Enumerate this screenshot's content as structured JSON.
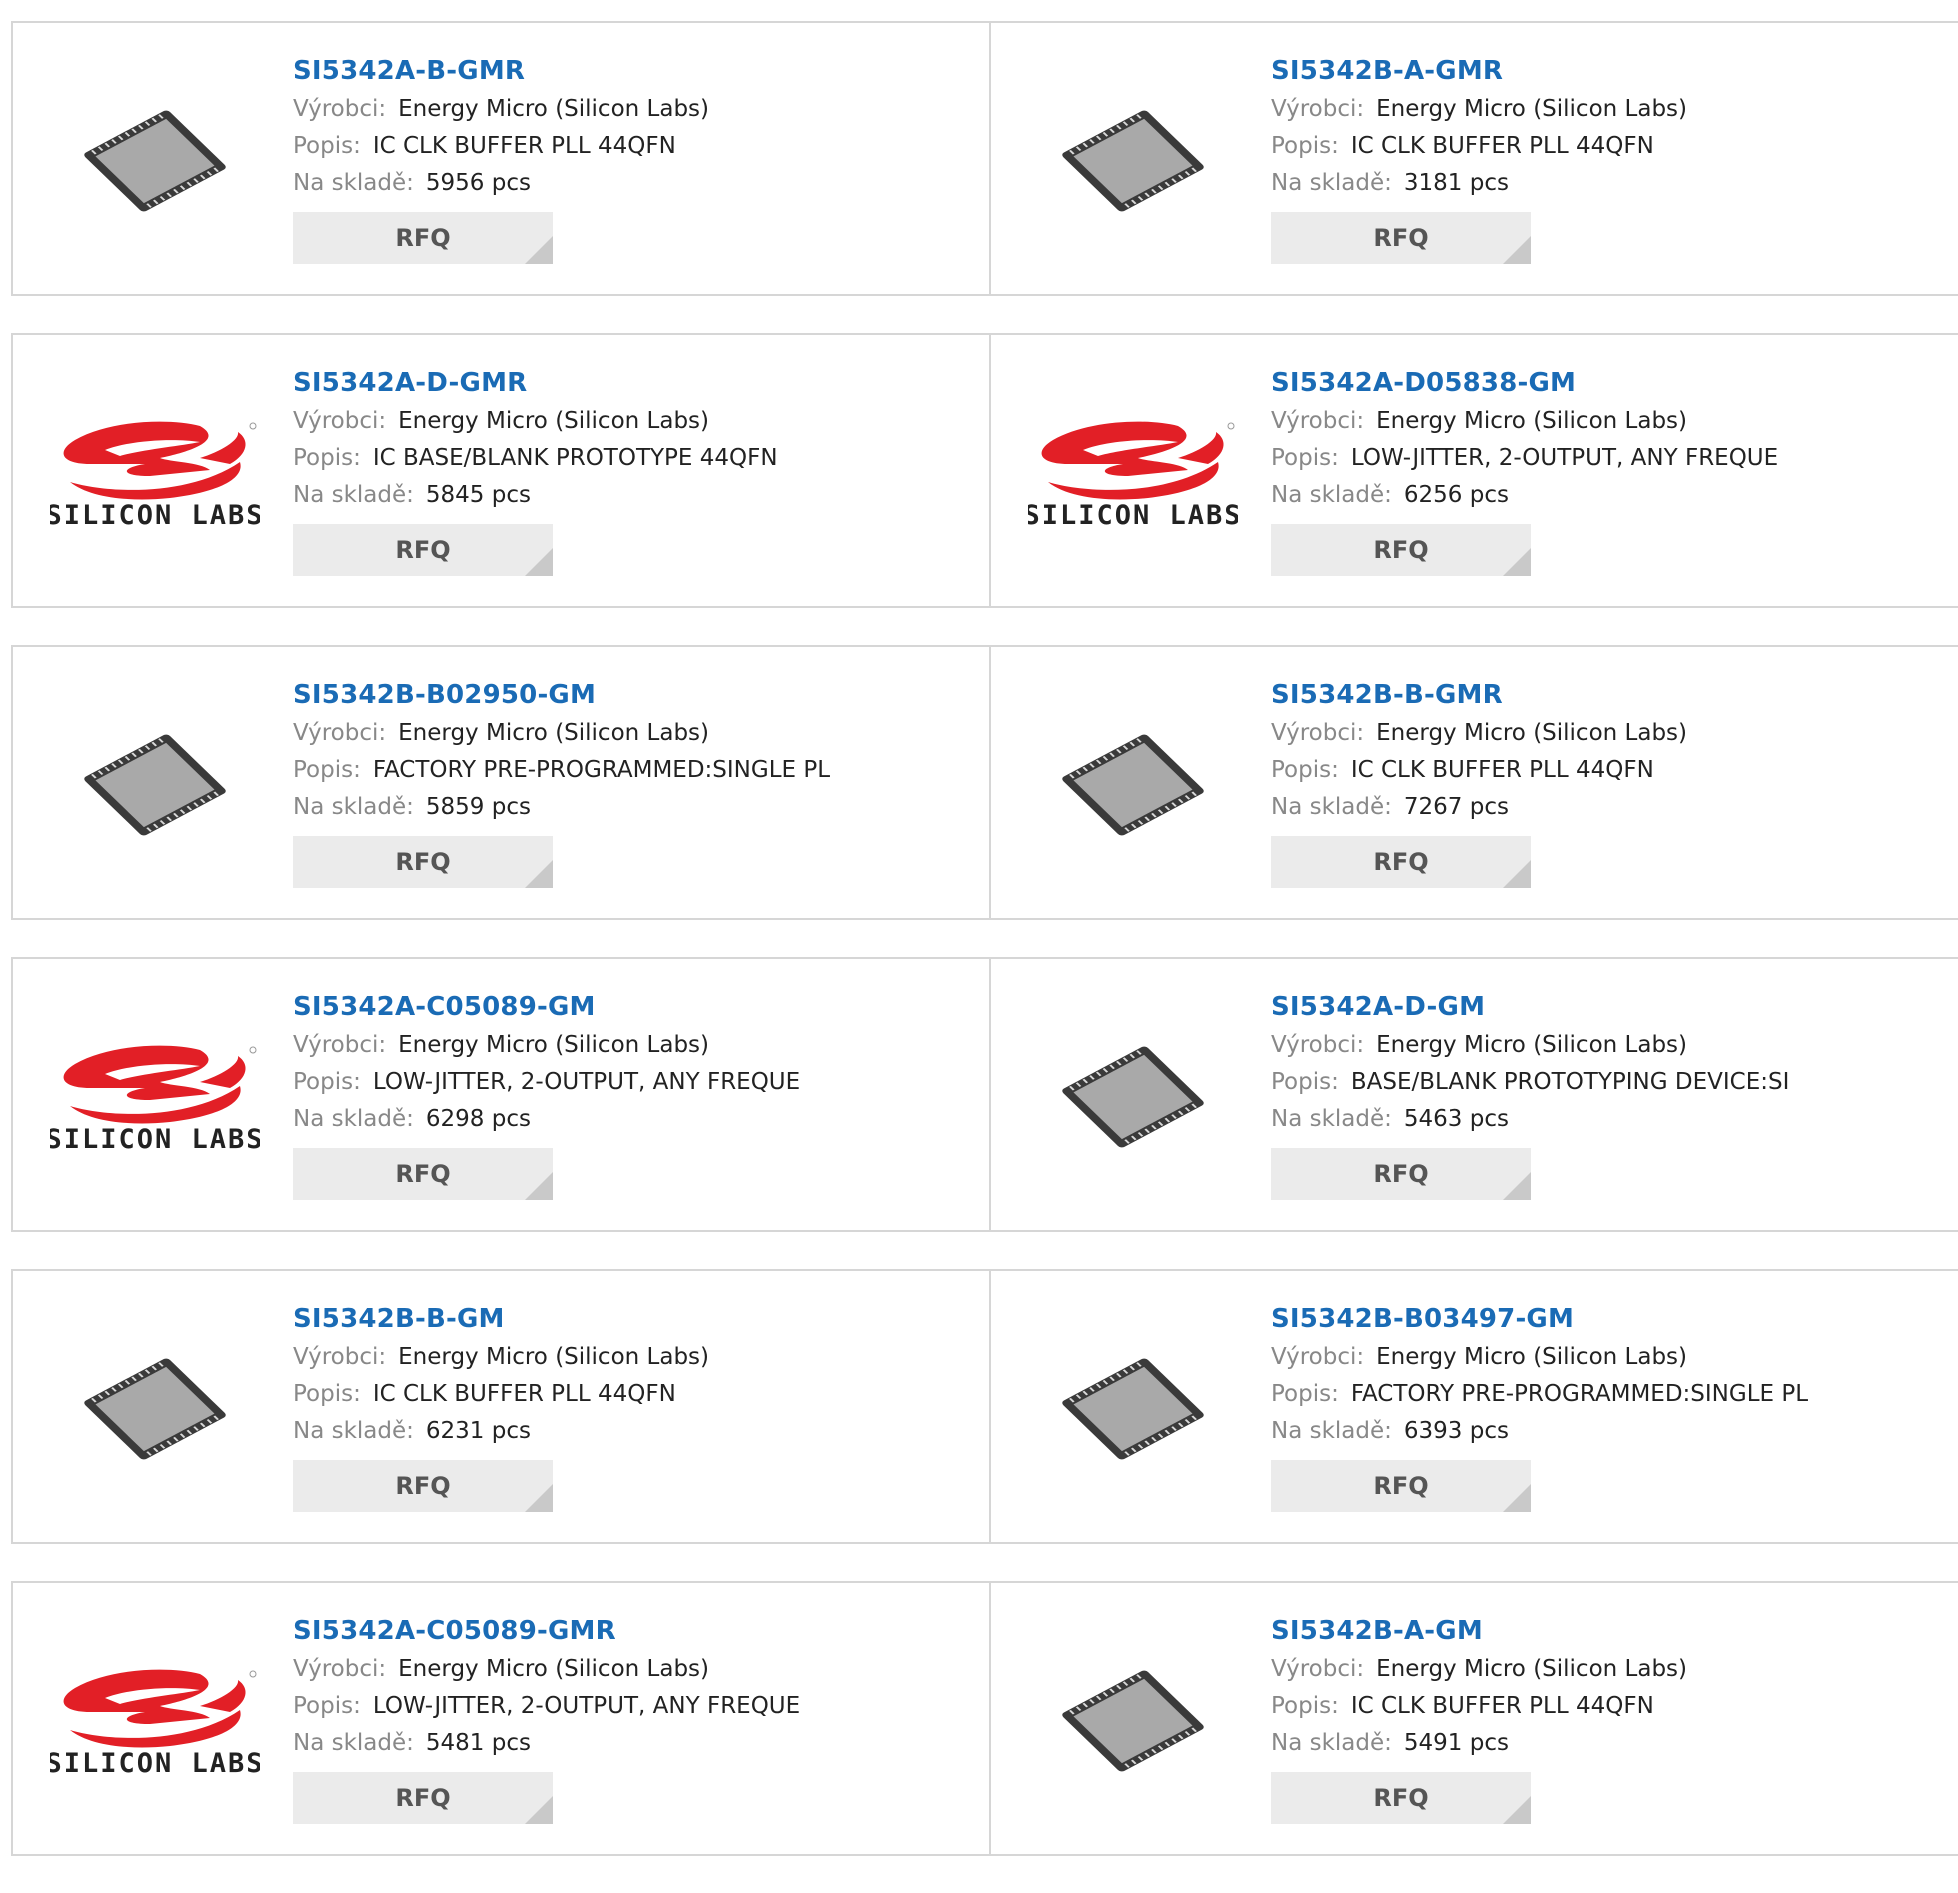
{
  "labels": {
    "manufacturer": "Výrobci:",
    "description": "Popis:",
    "stock": "Na skladě:",
    "rfq": "RFQ"
  },
  "products": [
    {
      "part": "SI5342A-B-GMR",
      "manufacturer": "Energy Micro (Silicon Labs)",
      "description": "IC CLK BUFFER PLL 44QFN",
      "stock": "5956 pcs",
      "image": "chip-icon"
    },
    {
      "part": "SI5342B-A-GMR",
      "manufacturer": "Energy Micro (Silicon Labs)",
      "description": "IC CLK BUFFER PLL 44QFN",
      "stock": "3181 pcs",
      "image": "chip-icon"
    },
    {
      "part": "SI5342A-D-GMR",
      "manufacturer": "Energy Micro (Silicon Labs)",
      "description": "IC BASE/BLANK PROTOTYPE 44QFN",
      "stock": "5845 pcs",
      "image": "silicon-labs-logo",
      "logo_text": "SILICON LABS"
    },
    {
      "part": "SI5342A-D05838-GM",
      "manufacturer": "Energy Micro (Silicon Labs)",
      "description": "LOW-JITTER, 2-OUTPUT, ANY FREQUE",
      "stock": "6256 pcs",
      "image": "silicon-labs-logo",
      "logo_text": "SILICON LABS"
    },
    {
      "part": "SI5342B-B02950-GM",
      "manufacturer": "Energy Micro (Silicon Labs)",
      "description": "FACTORY PRE-PROGRAMMED:SINGLE PL",
      "stock": "5859 pcs",
      "image": "chip-icon"
    },
    {
      "part": "SI5342B-B-GMR",
      "manufacturer": "Energy Micro (Silicon Labs)",
      "description": "IC CLK BUFFER PLL 44QFN",
      "stock": "7267 pcs",
      "image": "chip-icon"
    },
    {
      "part": "SI5342A-C05089-GM",
      "manufacturer": "Energy Micro (Silicon Labs)",
      "description": "LOW-JITTER, 2-OUTPUT, ANY FREQUE",
      "stock": "6298 pcs",
      "image": "silicon-labs-logo",
      "logo_text": "SILICON LABS"
    },
    {
      "part": "SI5342A-D-GM",
      "manufacturer": "Energy Micro (Silicon Labs)",
      "description": "BASE/BLANK PROTOTYPING DEVICE:SI",
      "stock": "5463 pcs",
      "image": "chip-icon"
    },
    {
      "part": "SI5342B-B-GM",
      "manufacturer": "Energy Micro (Silicon Labs)",
      "description": "IC CLK BUFFER PLL 44QFN",
      "stock": "6231 pcs",
      "image": "chip-icon"
    },
    {
      "part": "SI5342B-B03497-GM",
      "manufacturer": "Energy Micro (Silicon Labs)",
      "description": "FACTORY PRE-PROGRAMMED:SINGLE PL",
      "stock": "6393 pcs",
      "image": "chip-icon"
    },
    {
      "part": "SI5342A-C05089-GMR",
      "manufacturer": "Energy Micro (Silicon Labs)",
      "description": "LOW-JITTER, 2-OUTPUT, ANY FREQUE",
      "stock": "5481 pcs",
      "image": "silicon-labs-logo",
      "logo_text": "SILICON LABS"
    },
    {
      "part": "SI5342B-A-GM",
      "manufacturer": "Energy Micro (Silicon Labs)",
      "description": "IC CLK BUFFER PLL 44QFN",
      "stock": "5491 pcs",
      "image": "chip-icon"
    }
  ],
  "colors": {
    "part_link": "#1a6bb5",
    "logo_red": "#e21f26",
    "rfq_bg": "#ebebeb",
    "border": "#d6d6d6"
  }
}
